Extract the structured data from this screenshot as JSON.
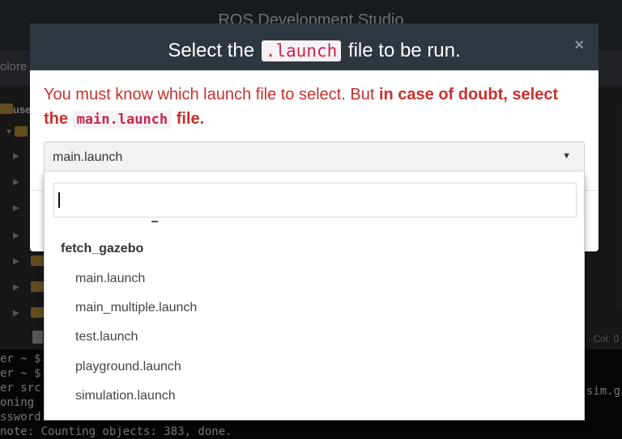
{
  "app": {
    "title": "ROS Development Studio"
  },
  "explorer": {
    "panel_label": "olore",
    "root_label": "use"
  },
  "statusbar": {
    "cursor": "0 · Col: 0"
  },
  "terminal": {
    "lines": [
      "er ~ $",
      "er ~ $",
      "er src",
      "oning",
      "ssword",
      "note: Counting objects: 383, done."
    ],
    "right_fragment": "sim.g"
  },
  "modal": {
    "title_before": "Select the",
    "title_code": ".launch",
    "title_after": "file to be run.",
    "close_glyph": "×",
    "warning_plain": "You must know which launch file to select. But ",
    "warning_bold": "in case of doubt, select the",
    "warning_code": "main.launch",
    "warning_end": "file."
  },
  "select": {
    "value": "main.launch",
    "arrow_glyph": "▼",
    "search_value": "",
    "group": "fetch_gazebo",
    "options": [
      "main.launch",
      "main_multiple.launch",
      "test.launch",
      "playground.launch",
      "simulation.launch"
    ]
  }
}
